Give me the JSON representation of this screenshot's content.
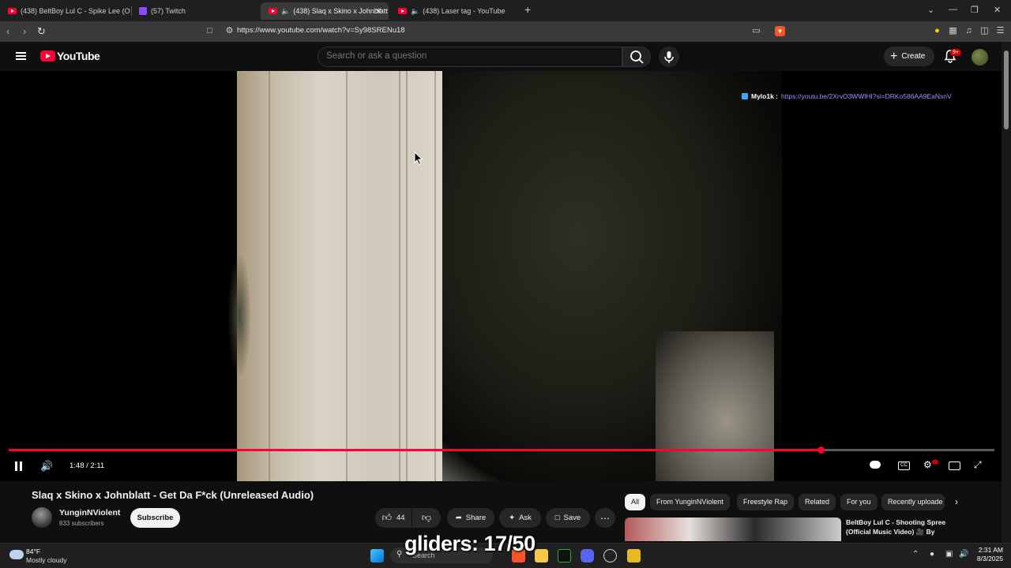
{
  "browser": {
    "tabs": [
      {
        "title": "(438) BeltBoy Lul C - Spike Lee (Offic",
        "active": false
      },
      {
        "title": "(57) Twitch",
        "active": false
      },
      {
        "title": "(438) Slaq x Skino x Johnblatt",
        "active": true
      },
      {
        "title": "(438) Laser tag - YouTube",
        "active": false
      }
    ],
    "url": "https://www.youtube.com/watch?v=Sy98SRENu18"
  },
  "masthead": {
    "logo_text": "YouTube",
    "search_placeholder": "Search or ask a question",
    "create_label": "Create",
    "notification_badge": "9+"
  },
  "player": {
    "overlay_user": "Mylo1k :",
    "overlay_link": "https://youtu.be/2XrvO3WWlHI?si=DRKo586AA9EaNsnV",
    "time": "1:48 / 2:11",
    "progress_fraction": 0.824
  },
  "video": {
    "title": "Slaq x Skino x Johnblatt - Get Da F*ck (Unreleased Audio)",
    "channel": "YunginNViolent",
    "subscribers": "833 subscribers",
    "subscribe_label": "Subscribe",
    "likes": "44",
    "share_label": "Share",
    "ask_label": "Ask",
    "save_label": "Save"
  },
  "chips": [
    "All",
    "From YunginNViolent",
    "Freestyle Rap",
    "Related",
    "For you",
    "Recently uploade"
  ],
  "recommendation": {
    "title": "BeltBoy Lul C - Shooting Spree (Official Music Video) 🎥 By"
  },
  "stream_overlay": "gliders: 17/50",
  "taskbar": {
    "temperature": "84°F",
    "weather": "Mostly cloudy",
    "search": "Search",
    "time": "2:31 AM",
    "date": "8/3/2025"
  }
}
